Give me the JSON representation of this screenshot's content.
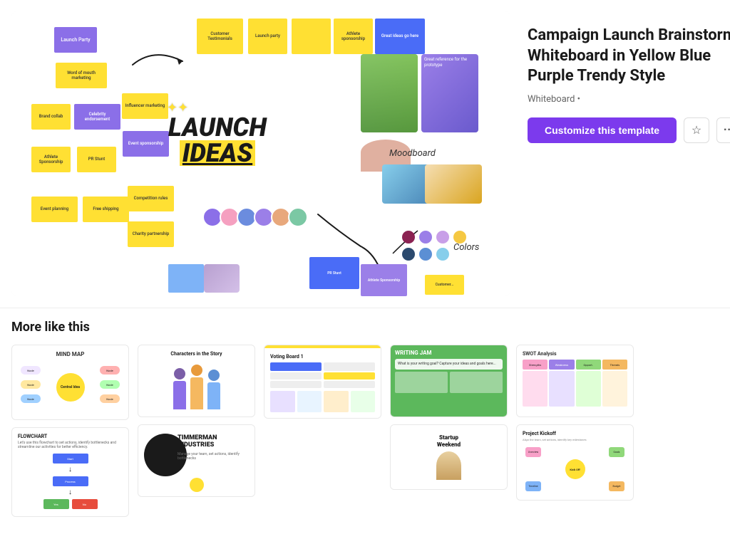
{
  "template": {
    "title": "Campaign Launch Brainstorm Whiteboard in Yellow Blue Purple Trendy Style",
    "subtitle": "Whiteboard •",
    "customize_label": "Customize this template",
    "star_icon": "☆",
    "more_icon": "•••"
  },
  "more_section": {
    "title": "More like this"
  },
  "thumbnails": [
    {
      "id": "mind-map",
      "label": "Mind Map"
    },
    {
      "id": "characters",
      "label": "Characters in the Story"
    },
    {
      "id": "flowchart",
      "label": "Flowchart"
    },
    {
      "id": "voting",
      "label": "Voting Board 1"
    },
    {
      "id": "timmerman",
      "label": "Timmerman Industries"
    },
    {
      "id": "writing-jam",
      "label": "Writing Jam"
    },
    {
      "id": "swot",
      "label": "SWOT Analysis"
    },
    {
      "id": "project-kickoff",
      "label": "Project Kickoff"
    },
    {
      "id": "startup",
      "label": "Startup Weekend"
    }
  ],
  "colors": {
    "customize_bg": "#7C3AED",
    "accent_yellow": "#FFE033",
    "accent_purple": "#8B6FE8",
    "accent_blue": "#4A6CF7"
  }
}
